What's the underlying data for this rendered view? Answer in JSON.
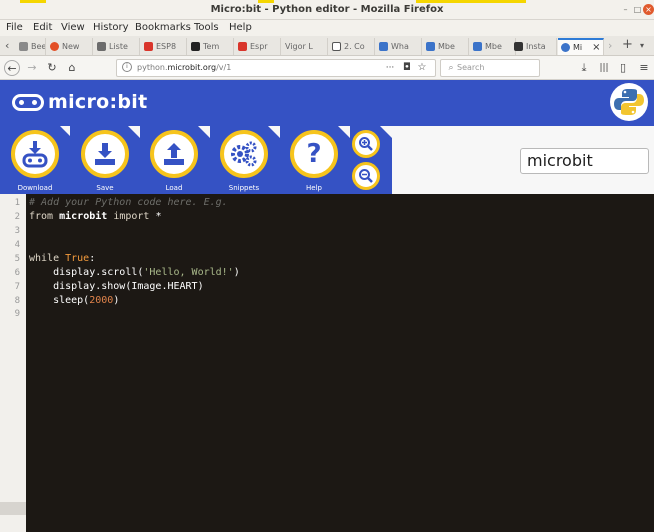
{
  "window": {
    "title": "Micro:bit - Python editor - Mozilla Firefox"
  },
  "menu": [
    "File",
    "Edit",
    "View",
    "History",
    "Bookmarks",
    "Tools",
    "Help"
  ],
  "tabs": [
    {
      "label": "Beer",
      "color": "#8a8a8a"
    },
    {
      "label": "New",
      "color": "#e34f26"
    },
    {
      "label": "Liste",
      "color": "#6c6c6c"
    },
    {
      "label": "ESP8",
      "color": "#d9352b"
    },
    {
      "label": "Tem",
      "color": "#222222"
    },
    {
      "label": "Espr",
      "color": "#d9352b"
    },
    {
      "label": "Vigor L",
      "color": "#ffffff"
    },
    {
      "label": "2. Co",
      "color": "#555555"
    },
    {
      "label": "Wha",
      "color": "#3b73c9"
    },
    {
      "label": "Mbe",
      "color": "#3b73c9"
    },
    {
      "label": "Mbe",
      "color": "#3b73c9"
    },
    {
      "label": "Insta",
      "color": "#333333"
    },
    {
      "label": "Mi",
      "color": "#3b73c9",
      "active": true
    }
  ],
  "nav": {
    "url_prefix": "python.",
    "url_domain": "microbit.org",
    "url_suffix": "/v/1",
    "url_dots": "···",
    "search_placeholder": "Search"
  },
  "brand": {
    "logo_text": "micro:bit"
  },
  "toolbar": {
    "download": "Download",
    "save": "Save",
    "load": "Load",
    "snippets": "Snippets",
    "help": "Help"
  },
  "project_name": "microbit",
  "code": {
    "line_numbers": [
      "1",
      "2",
      "3",
      "4",
      "5",
      "6",
      "7",
      "8",
      "9"
    ],
    "l1": "# Add your Python code here. E.g.",
    "l2_kw1": "from",
    "l2_mod": " microbit ",
    "l2_kw2": "import",
    "l2_rest": " *",
    "l5_kw": "while ",
    "l5_true": "True",
    "l5_colon": ":",
    "l6_pre": "    display.scroll(",
    "l6_str": "'Hello, World!'",
    "l6_post": ")",
    "l7": "    display.show(Image.HEART)",
    "l8_pre": "    sleep(",
    "l8_num": "2000",
    "l8_post": ")"
  },
  "colors": {
    "brand_blue": "#3552c4",
    "accent_yellow": "#f6c41c",
    "editor_bg": "#1c1814"
  }
}
